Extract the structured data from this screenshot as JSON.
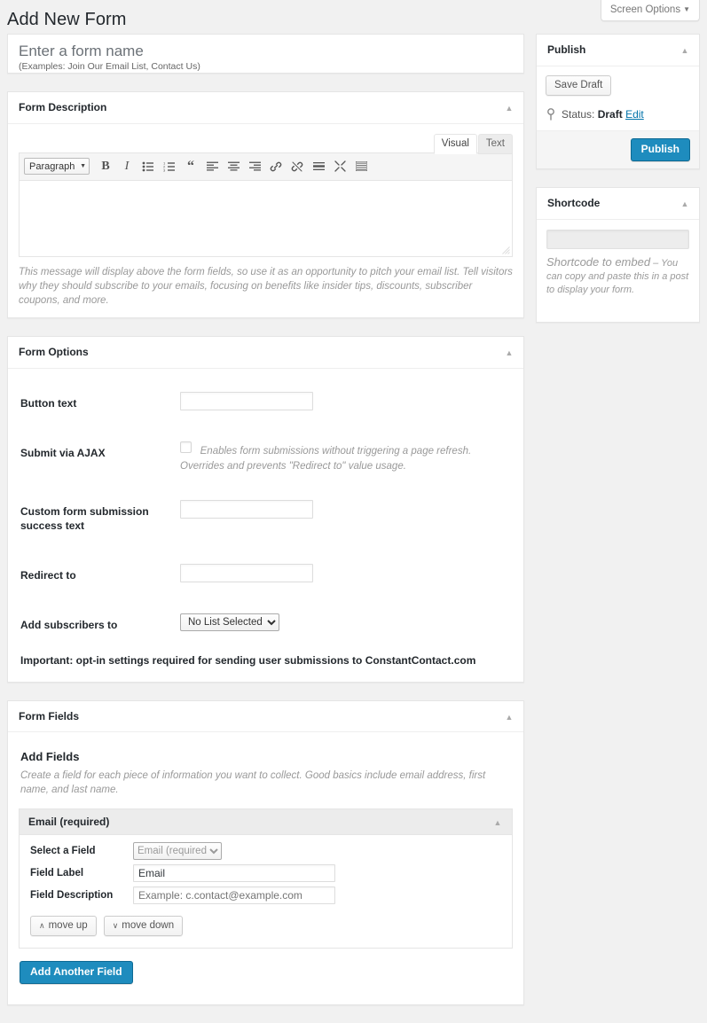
{
  "screen_options": {
    "label": "Screen Options",
    "caret": "▼"
  },
  "page_title": "Add New Form",
  "title_box": {
    "placeholder": "Enter a form name",
    "examples": "(Examples: Join Our Email List, Contact Us)"
  },
  "form_description": {
    "panel_title": "Form Description",
    "toggle": "▲",
    "tabs": {
      "visual": "Visual",
      "text": "Text"
    },
    "toolbar": {
      "format_select": "Paragraph",
      "format_caret": "▼",
      "buttons": [
        "bold-icon",
        "italic-icon",
        "bulleted-list-icon",
        "numbered-list-icon",
        "blockquote-icon",
        "align-left-icon",
        "align-center-icon",
        "align-right-icon",
        "link-icon",
        "unlink-icon",
        "insert-read-more-icon",
        "fullscreen-icon",
        "kitchen-sink-icon"
      ]
    },
    "content": "",
    "help_text": "This message will display above the form fields, so use it as an opportunity to pitch your email list. Tell visitors why they should subscribe to your emails, focusing on benefits like insider tips, discounts, subscriber coupons, and more."
  },
  "form_options": {
    "panel_title": "Form Options",
    "toggle": "▲",
    "rows": [
      {
        "label": "Button text",
        "type": "text",
        "value": "",
        "placeholder": ""
      },
      {
        "label": "Submit via AJAX",
        "type": "checkbox",
        "checked": false,
        "description": "Enables form submissions without triggering a page refresh. Overrides and prevents \"Redirect to\" value usage."
      },
      {
        "label": "Custom form submission success text",
        "type": "text",
        "value": "",
        "placeholder": ""
      },
      {
        "label": "Redirect to",
        "type": "text",
        "value": "",
        "placeholder": ""
      },
      {
        "label": "Add subscribers to",
        "type": "select",
        "value": "No List Selected",
        "options": [
          "No List Selected"
        ]
      }
    ],
    "important_note": "Important: opt-in settings required for sending user submissions to ConstantContact.com"
  },
  "form_fields": {
    "panel_title": "Form Fields",
    "toggle": "▲",
    "add_fields_title": "Add Fields",
    "add_fields_desc": "Create a field for each piece of information you want to collect. Good basics include email address, first name, and last name.",
    "groups": [
      {
        "title": "Email (required)",
        "toggle": "▲",
        "select_label": "Select a Field",
        "select_value": "Email (required)",
        "select_options": [
          "Email (required)"
        ],
        "label_label": "Field Label",
        "label_value": "Email",
        "desc_label": "Field Description",
        "desc_value": "",
        "desc_placeholder": "Example: c.contact@example.com",
        "move_up": "move up",
        "move_up_icon": "∧",
        "move_down": "move down",
        "move_down_icon": "∨"
      }
    ],
    "add_another_label": "Add Another Field"
  },
  "publish_box": {
    "panel_title": "Publish",
    "toggle": "▲",
    "save_draft": "Save Draft",
    "status_label": "Status:",
    "status_value": "Draft",
    "edit_link": "Edit",
    "publish_button": "Publish"
  },
  "shortcode_box": {
    "panel_title": "Shortcode",
    "toggle": "▲",
    "input_value": "",
    "desc_lead": "Shortcode to embed",
    "desc_rest": " – You can copy and paste this in a post to display your form."
  },
  "colors": {
    "accent": "#1e8cbe",
    "page_bg": "#f1f1f1",
    "panel_bg": "#ffffff",
    "border": "#e5e5e5",
    "link": "#0073aa",
    "muted_text": "#999999"
  }
}
